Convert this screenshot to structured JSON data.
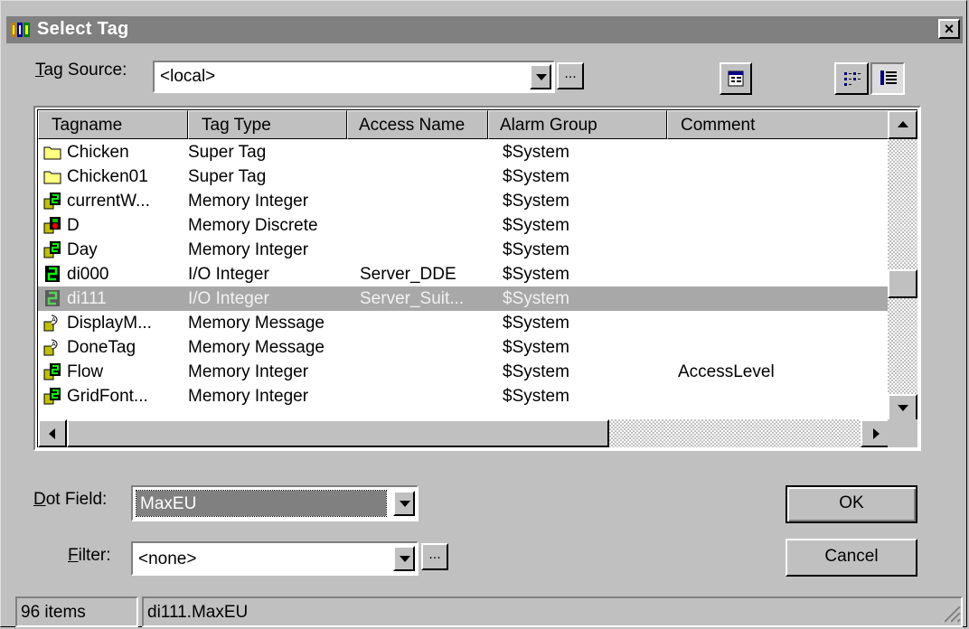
{
  "window": {
    "title": "Select Tag",
    "close_glyph": "×"
  },
  "tag_source": {
    "label_accel": "T",
    "label_rest": "ag Source:",
    "value": "<local>",
    "browse_label": "..."
  },
  "toolbar": {
    "properties_icon": "properties-icon",
    "details_view_icon": "details-view-icon",
    "list_view_icon": "list-view-icon"
  },
  "list": {
    "columns": [
      "Tagname",
      "Tag Type",
      "Access Name",
      "Alarm Group",
      "Comment"
    ],
    "rows": [
      {
        "icon": "super-tag-folder-icon",
        "name": "Chicken",
        "type": "Super Tag",
        "access": "",
        "group": "$System",
        "comment": ""
      },
      {
        "icon": "super-tag-folder-icon",
        "name": "Chicken01",
        "type": "Super Tag",
        "access": "",
        "group": "$System",
        "comment": ""
      },
      {
        "icon": "memory-integer-icon",
        "name": "currentW...",
        "type": "Memory Integer",
        "access": "",
        "group": "$System",
        "comment": ""
      },
      {
        "icon": "memory-discrete-icon",
        "name": "D",
        "type": "Memory Discrete",
        "access": "",
        "group": "$System",
        "comment": ""
      },
      {
        "icon": "memory-integer-icon",
        "name": "Day",
        "type": "Memory Integer",
        "access": "",
        "group": "$System",
        "comment": ""
      },
      {
        "icon": "io-integer-icon",
        "name": "di000",
        "type": "I/O Integer",
        "access": "Server_DDE",
        "group": "$System",
        "comment": ""
      },
      {
        "icon": "io-integer-icon",
        "name": "di111",
        "type": "I/O Integer",
        "access": "Server_Suit...",
        "group": "$System",
        "comment": "",
        "selected": true
      },
      {
        "icon": "memory-message-icon",
        "name": "DisplayM...",
        "type": "Memory Message",
        "access": "",
        "group": "$System",
        "comment": ""
      },
      {
        "icon": "memory-message-icon",
        "name": "DoneTag",
        "type": "Memory Message",
        "access": "",
        "group": "$System",
        "comment": ""
      },
      {
        "icon": "memory-integer-icon",
        "name": "Flow",
        "type": "Memory Integer",
        "access": "",
        "group": "$System",
        "comment": "AccessLevel"
      },
      {
        "icon": "memory-integer-icon",
        "name": "GridFont...",
        "type": "Memory Integer",
        "access": "",
        "group": "$System",
        "comment": ""
      }
    ]
  },
  "dot_field": {
    "label_accel": "D",
    "label_rest": "ot Field:",
    "value": "MaxEU"
  },
  "filter": {
    "label_accel": "F",
    "label_rest": "ilter:",
    "value": "<none>",
    "browse_label": "..."
  },
  "buttons": {
    "ok": "OK",
    "cancel": "Cancel"
  },
  "status": {
    "count": "96 items",
    "selection": "di111.MaxEU"
  },
  "colors": {
    "face": "#c0c0c0",
    "selected_row": "#a8a8a8",
    "title_inactive": "#808080"
  }
}
